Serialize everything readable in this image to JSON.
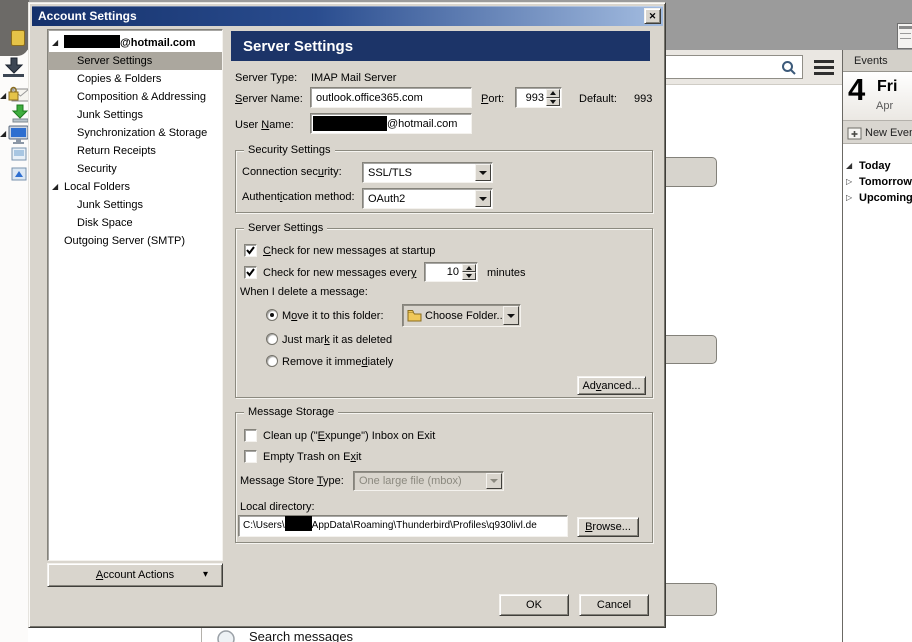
{
  "glyphs": {
    "close": "✕",
    "tree_open": "◢",
    "tree_closed": "▷",
    "menu_arrow": "▾"
  },
  "colors": {
    "face": "#d9d5cd",
    "titlebar_left": "#15316b",
    "titlebar_right": "#a3bce0",
    "header_navy": "#1c3468",
    "selection_gray": "#aba79e"
  },
  "dialog": {
    "title": "Account Settings",
    "sidebar": {
      "account_suffix": "@hotmail.com",
      "items": [
        "Server Settings",
        "Copies & Folders",
        "Composition & Addressing",
        "Junk Settings",
        "Synchronization & Storage",
        "Return Receipts",
        "Security"
      ],
      "local_folders": "Local Folders",
      "local_items": [
        "Junk Settings",
        "Disk Space"
      ],
      "outgoing": "Outgoing Server (SMTP)",
      "account_actions": {
        "t": "Account Actions",
        "k": "A"
      }
    },
    "header": "Server Settings",
    "fields": {
      "server_type_label": "Server Type:",
      "server_type_value": "IMAP Mail Server",
      "server_name_label": {
        "t": "Server Name:",
        "k": "S"
      },
      "server_name_value": "outlook.office365.com",
      "port_label": {
        "t": "Port:",
        "k": "P"
      },
      "port_value": "993",
      "default_label": "Default:",
      "default_value": "993",
      "user_name_label": {
        "t": "User Name:",
        "k": "N"
      },
      "user_name_suffix": "@hotmail.com"
    },
    "security": {
      "title": "Security Settings",
      "connection_label": {
        "t": "Connection security:",
        "k": "u"
      },
      "connection_value": "SSL/TLS",
      "auth_label": {
        "t": "Authentication method:",
        "k": "i"
      },
      "auth_value": "OAuth2"
    },
    "server": {
      "title": "Server Settings",
      "check_startup": {
        "t": "Check for new messages at startup",
        "k": "C"
      },
      "check_every": {
        "t": "Check for new messages every",
        "k": "y"
      },
      "check_every_value": "10",
      "minutes": "minutes",
      "when_delete": "When I delete a message:",
      "move_folder": {
        "t": "Move it to this folder:",
        "k": "o"
      },
      "choose_folder": "Choose Folder...",
      "mark_deleted": {
        "t": "Just mark it as deleted",
        "k": "k"
      },
      "remove_immediately": {
        "t": "Remove it immediately",
        "k": "d"
      },
      "advanced": {
        "t": "Advanced...",
        "k": "v"
      }
    },
    "storage": {
      "title": "Message Storage",
      "clean_up": {
        "t": "Clean up (\"Expunge\") Inbox on Exit",
        "k": "E"
      },
      "empty_trash": {
        "t": "Empty Trash on Exit",
        "k": "x"
      },
      "store_type_label": {
        "t": "Message Store Type:",
        "k": "T"
      },
      "store_type_value": "One large file (mbox)",
      "local_dir_label": "Local directory:",
      "local_dir_prefix": "C:\\Users\\",
      "local_dir_suffix": "AppData\\Roaming\\Thunderbird\\Profiles\\q930livl.de",
      "browse": {
        "t": "Browse...",
        "k": "B"
      }
    },
    "ok": "OK",
    "cancel": "Cancel"
  },
  "background": {
    "events": {
      "header": "Events",
      "day_number": "4",
      "day_name": "Fri",
      "month": "Apr",
      "new_event": "New Event",
      "tree": [
        "Today",
        "Tomorrow",
        "Upcoming"
      ]
    },
    "search_messages": "Search messages"
  }
}
